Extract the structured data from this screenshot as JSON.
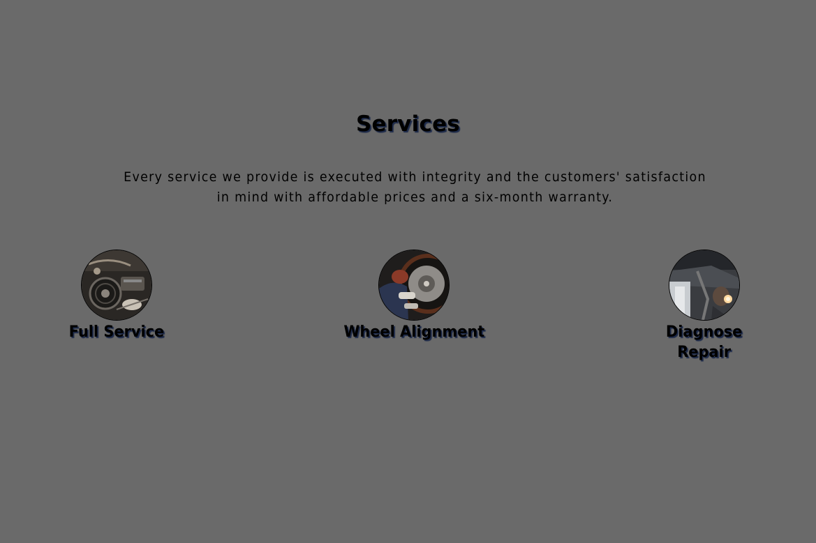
{
  "section": {
    "title": "Services",
    "description": "Every service we provide is executed with integrity and the customers' satisfaction in mind with affordable prices and a six-month warranty."
  },
  "services": [
    {
      "name": "Full Service",
      "image_icon": "engine-bay-photo"
    },
    {
      "name": "Wheel Alignment",
      "image_icon": "wheel-mechanic-photo"
    },
    {
      "name": "Diagnose\nRepair",
      "image_icon": "undercarriage-inspection-photo"
    }
  ],
  "colors": {
    "background": "#6a6a6a",
    "text": "#000000",
    "text_shadow": "#1d2a4a"
  }
}
